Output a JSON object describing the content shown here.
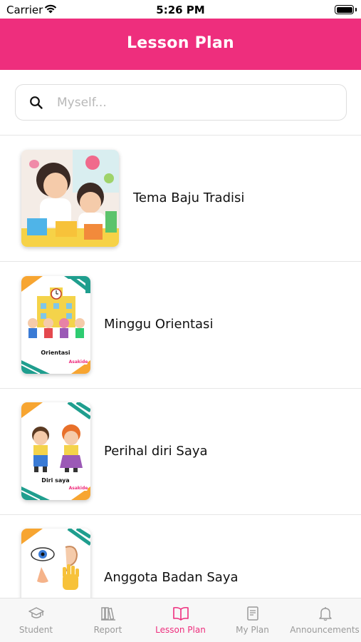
{
  "status_bar": {
    "carrier": "Carrier",
    "time": "5:26 PM"
  },
  "header": {
    "title": "Lesson Plan"
  },
  "search": {
    "placeholder": "Myself..."
  },
  "lessons": [
    {
      "title": "Tema Baju Tradisi",
      "thumbnail": "photo of two children playing with toy blocks"
    },
    {
      "title": "Minggu Orientasi",
      "thumbnail_caption": "Orientasi",
      "thumbnail_badge": "Asakide"
    },
    {
      "title": "Perihal diri Saya",
      "thumbnail_caption": "Diri saya",
      "thumbnail_badge": "Asakide"
    },
    {
      "title": "Anggota Badan Saya"
    }
  ],
  "tabs": [
    {
      "label": "Student",
      "icon": "graduation-cap-icon",
      "active": false
    },
    {
      "label": "Report",
      "icon": "books-icon",
      "active": false
    },
    {
      "label": "Lesson Plan",
      "icon": "open-book-icon",
      "active": true
    },
    {
      "label": "My Plan",
      "icon": "notebook-icon",
      "active": false
    },
    {
      "label": "Announcements",
      "icon": "bell-icon",
      "active": false
    }
  ],
  "colors": {
    "accent": "#ee2e7d",
    "tab_inactive": "#9a9a9a",
    "stripe_teal": "#1f9e8e",
    "stripe_orange": "#f7a531"
  }
}
